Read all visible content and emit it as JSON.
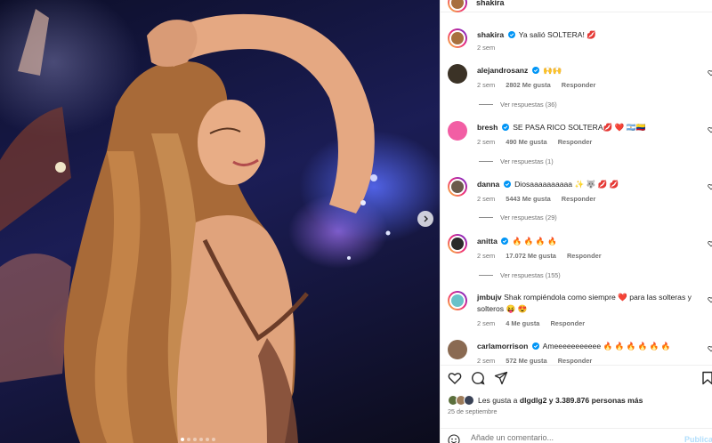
{
  "post": {
    "author": "shakira",
    "caption_user": "shakira",
    "caption_text": "Ya salió SOLTERA! 💋",
    "caption_time": "2 sem"
  },
  "comments": [
    {
      "user": "alejandrosanz",
      "verified": true,
      "text": "🙌🙌",
      "time": "2 sem",
      "likes": "2802 Me gusta",
      "reply": "Responder",
      "replies": "Ver respuestas (36)",
      "avatar_color": "#3b3226"
    },
    {
      "user": "bresh",
      "verified": true,
      "text": "SE PASA RICO SOLTERA💋 ❤️ 🇦🇷🇨🇴",
      "time": "2 sem",
      "likes": "490 Me gusta",
      "reply": "Responder",
      "replies": "Ver respuestas (1)",
      "avatar_color": "#f25ea4"
    },
    {
      "user": "danna",
      "verified": true,
      "text": "Diosaaaaaaaaaa ✨ 🐺 💋 💋",
      "time": "2 sem",
      "likes": "5443 Me gusta",
      "reply": "Responder",
      "replies": "Ver respuestas (29)",
      "avatar_color": "#6b5b4c"
    },
    {
      "user": "anitta",
      "verified": true,
      "text": "🔥 🔥 🔥 🔥",
      "time": "2 sem",
      "likes": "17.072 Me gusta",
      "reply": "Responder",
      "replies": "Ver respuestas (155)",
      "avatar_color": "#2a2a2a"
    },
    {
      "user": "jmbujv",
      "verified": false,
      "text": "Shak rompiéndola como siempre ❤️  para las solteras y solteros 😝 😍",
      "time": "2 sem",
      "likes": "4 Me gusta",
      "reply": "Responder",
      "replies": "",
      "avatar_color": "#69c2c9"
    },
    {
      "user": "carlamorrison",
      "verified": true,
      "text": "Ameeeeeeeeeee 🔥 🔥 🔥 🔥 🔥 🔥",
      "time": "2 sem",
      "likes": "572 Me gusta",
      "reply": "Responder",
      "replies": "",
      "avatar_color": "#8a6a52"
    }
  ],
  "likes": {
    "prefix": "Les gusta a",
    "user": "dlgdlg2",
    "suffix": "y 3.389.876 personas más"
  },
  "date": "25 de septiembre",
  "comment_box": {
    "placeholder": "Añade un comentario...",
    "publish": "Publicar"
  },
  "icons": {
    "like": "heart-icon",
    "comment": "comment-icon",
    "share": "share-icon",
    "save": "bookmark-icon",
    "emoji": "emoji-icon",
    "next": "chevron-right-icon"
  },
  "colors": {
    "verified": "#0095f6",
    "publish": "#b2dffc"
  }
}
